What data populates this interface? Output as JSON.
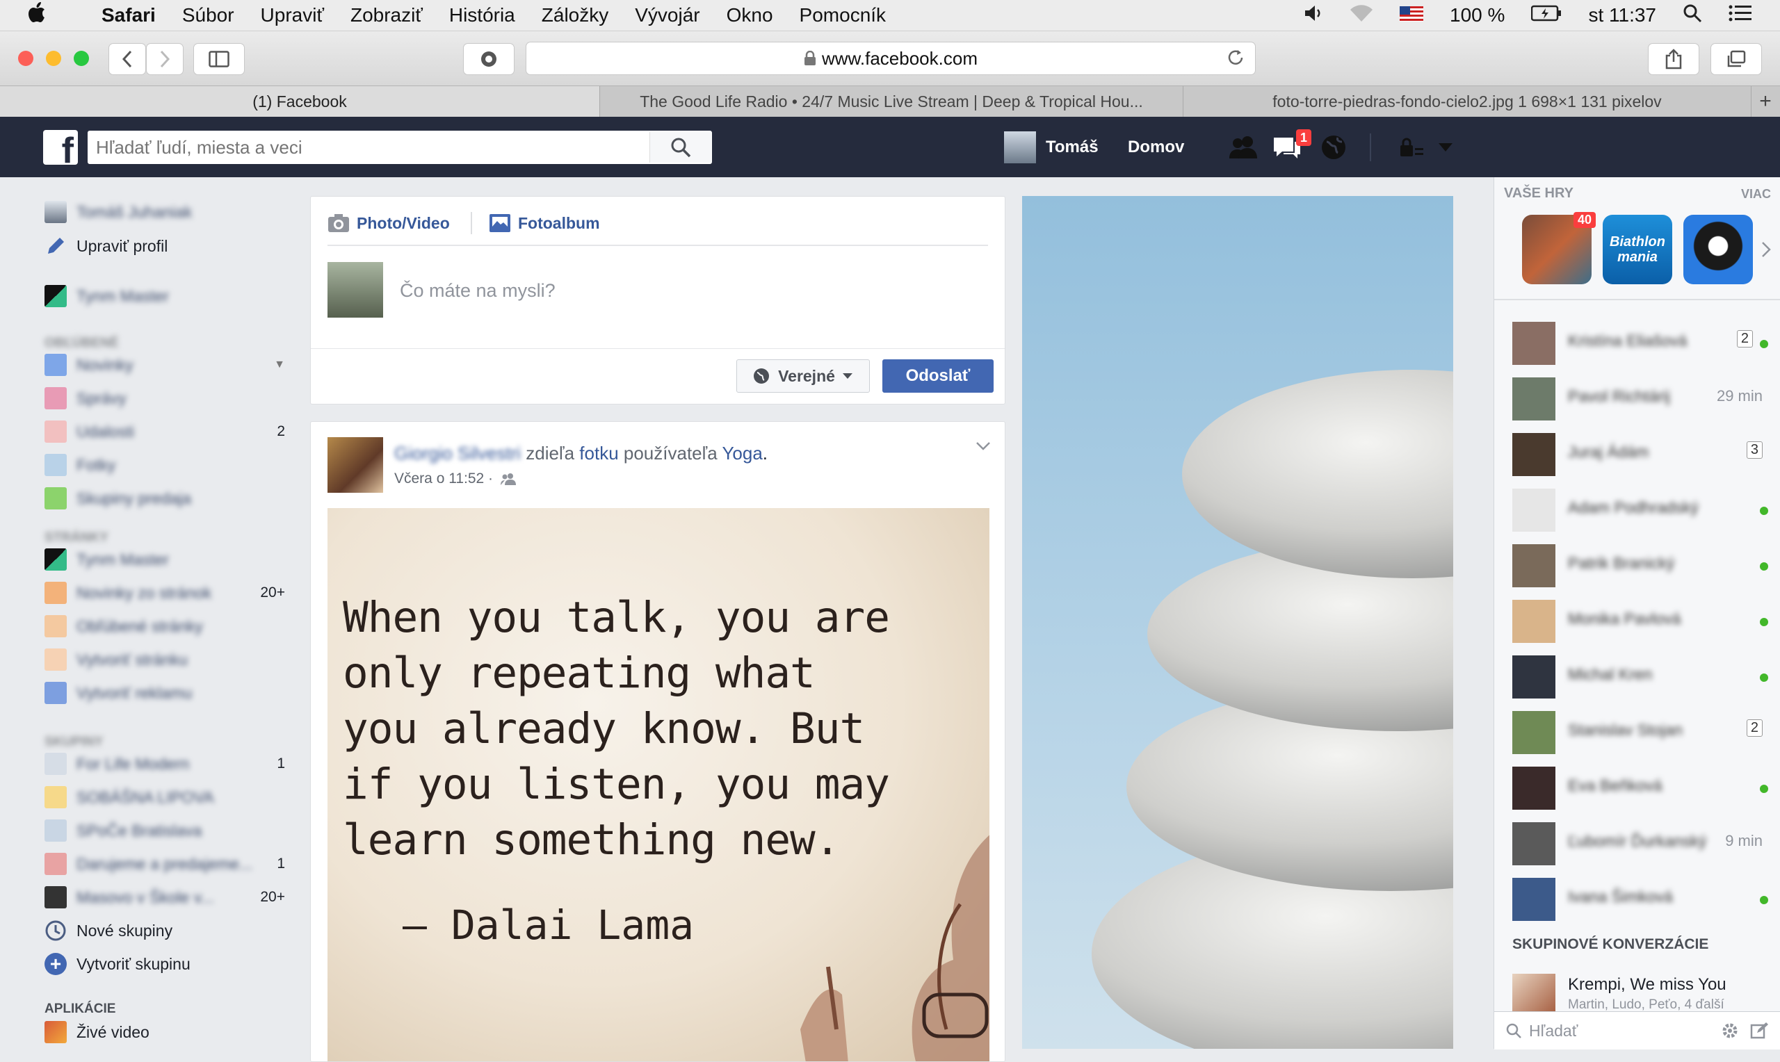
{
  "menubar": {
    "app": "Safari",
    "items": [
      "Súbor",
      "Upraviť",
      "Zobraziť",
      "História",
      "Záložky",
      "Vývojár",
      "Okno",
      "Pomocník"
    ],
    "battery": "100 %",
    "clock": "st 11:37"
  },
  "browser": {
    "url": "www.facebook.com",
    "tabs": [
      "(1) Facebook",
      "The Good Life Radio • 24/7 Music Live Stream | Deep & Tropical Hou...",
      "foto-torre-piedras-fondo-cielo2.jpg 1 698×1 131 pixelov"
    ]
  },
  "fb_header": {
    "search_placeholder": "Hľadať ľudí, miesta a veci",
    "user": "Tomáš",
    "home": "Domov",
    "notif_count": "1"
  },
  "left_nav": {
    "profile_name": "Tomáš Juhaniak",
    "edit_profile": "Upraviť profil",
    "page_name": "Tynm Master",
    "section_favorites": "OBĽÚBENÉ",
    "favorites": [
      {
        "label": "Novinky",
        "count": ""
      },
      {
        "label": "Správy",
        "count": ""
      },
      {
        "label": "Udalosti",
        "count": "2"
      },
      {
        "label": "Fotky",
        "count": ""
      },
      {
        "label": "Skupiny predaja",
        "count": ""
      }
    ],
    "section_pages": "STRÁNKY",
    "pages": [
      {
        "label": "Tynm Master",
        "count": ""
      },
      {
        "label": "Novinky zo stránok",
        "count": "20+"
      },
      {
        "label": "Obľúbené stránky",
        "count": ""
      },
      {
        "label": "Vytvoriť stránku",
        "count": ""
      },
      {
        "label": "Vytvoriť reklamu",
        "count": ""
      }
    ],
    "section_groups": "SKUPINY",
    "groups": [
      {
        "label": "For Life Modern",
        "count": "1"
      },
      {
        "label": "SOBÁŠNA LIPOVA",
        "count": ""
      },
      {
        "label": "SPoČe Bratislava",
        "count": ""
      },
      {
        "label": "Darujeme a predajeme...",
        "count": "1"
      },
      {
        "label": "Masovo v Škole v...",
        "count": "20+"
      }
    ],
    "new_groups": "Nové skupiny",
    "create_group": "Vytvoriť skupinu",
    "section_apps": "APLIKÁCIE",
    "live_video": "Živé video"
  },
  "composer": {
    "photo_video": "Photo/Video",
    "album": "Fotoalbum",
    "placeholder": "Čo máte na mysli?",
    "privacy": "Verejné",
    "post_button": "Odoslať"
  },
  "post": {
    "author": "Giorgio Silvestri",
    "shares": "zdieľa",
    "photo": "fotku",
    "of_user": "používateľa",
    "page": "Yoga",
    "period": ".",
    "time": "Včera o 11:52 ·",
    "quote_lines": [
      "When you talk, you are",
      "only repeating what",
      "you already know. But",
      "if you listen, you may",
      "learn something new."
    ],
    "quote_author": "– Dalai Lama"
  },
  "right_rail": {
    "games_title": "VAŠE HRY",
    "more": "VIAC",
    "game_badge": "40",
    "game2_label": "Biathlon mania",
    "contacts": [
      {
        "name": "Kristína Eliašová",
        "meta": "2",
        "online": true
      },
      {
        "name": "Pavol Richtárij",
        "meta": "29 min",
        "online": false
      },
      {
        "name": "Juraj Ádám",
        "meta": "3",
        "online": false
      },
      {
        "name": "Adam Podhradský",
        "meta": "",
        "online": true
      },
      {
        "name": "Patrik Branický",
        "meta": "",
        "online": true
      },
      {
        "name": "Monika Pavlová",
        "meta": "",
        "online": true
      },
      {
        "name": "Michal Kren",
        "meta": "",
        "online": true
      },
      {
        "name": "Stanislav Stojan",
        "meta": "2",
        "online": false
      },
      {
        "name": "Eva Beňková",
        "meta": "",
        "online": true
      },
      {
        "name": "Ľubomír Ďurkanský",
        "meta": "9 min",
        "online": false
      },
      {
        "name": "Ivana Šimková",
        "meta": "",
        "online": true
      }
    ],
    "group_convos_title": "SKUPINOVÉ KONVERZÁCIE",
    "group_convo_name": "Krempi, We miss You",
    "group_convo_members": "Martin, Ludo, Peťo, 4 ďalší",
    "chat_search": "Hľadať"
  },
  "colors": {
    "fb_bar": "#252b3d",
    "link": "#365899",
    "button": "#4267b2",
    "online": "#42b72a",
    "notif": "#fa3e3e"
  }
}
